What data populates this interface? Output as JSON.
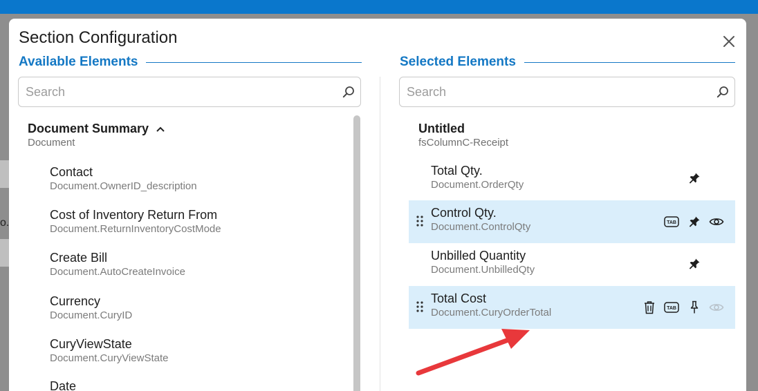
{
  "dialog": {
    "title": "Section Configuration",
    "background_text": "o."
  },
  "available": {
    "heading": "Available Elements",
    "search_placeholder": "Search",
    "group": {
      "title": "Document Summary",
      "subtitle": "Document"
    },
    "items": [
      {
        "label": "Contact",
        "sub": "Document.OwnerID_description"
      },
      {
        "label": "Cost of Inventory Return From",
        "sub": "Document.ReturnInventoryCostMode"
      },
      {
        "label": "Create Bill",
        "sub": "Document.AutoCreateInvoice"
      },
      {
        "label": "Currency",
        "sub": "Document.CuryID"
      },
      {
        "label": "CuryViewState",
        "sub": "Document.CuryViewState"
      },
      {
        "label": "Date",
        "sub": ""
      }
    ]
  },
  "selected": {
    "heading": "Selected Elements",
    "search_placeholder": "Search",
    "group": {
      "title": "Untitled",
      "subtitle": "fsColumnC-Receipt"
    },
    "items": [
      {
        "label": "Total Qty.",
        "sub": "Document.OrderQty"
      },
      {
        "label": "Control Qty.",
        "sub": "Document.ControlQty"
      },
      {
        "label": "Unbilled Quantity",
        "sub": "Document.UnbilledQty"
      },
      {
        "label": "Total Cost",
        "sub": "Document.CuryOrderTotal"
      }
    ],
    "tab_badge": "TAB"
  },
  "colors": {
    "accent": "#1478c4",
    "highlight_row": "#daeefb",
    "arrow": "#e8383b"
  }
}
